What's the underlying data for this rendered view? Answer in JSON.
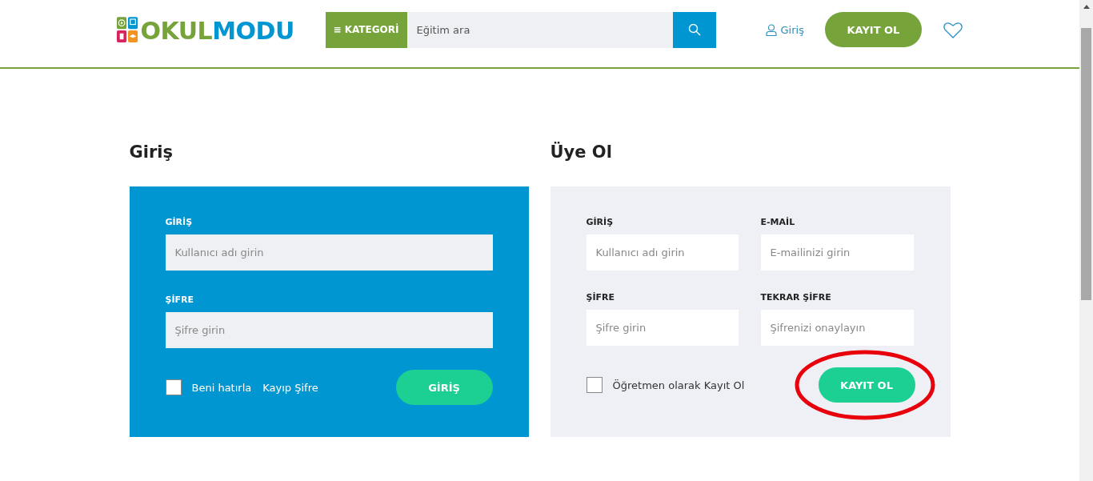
{
  "header": {
    "logo": {
      "part_1": "OKUL",
      "part_2": "MODU"
    },
    "category_button": "≡ KATEGORİ",
    "search": {
      "placeholder": "Eğitim ara"
    },
    "login_link": "Giriş",
    "register_button": "KAYIT OL"
  },
  "login": {
    "title": "Giriş",
    "fields": [
      {
        "label": "GİRİŞ",
        "placeholder": "Kullanıcı adı girin"
      },
      {
        "label": "ŞİFRE",
        "placeholder": "Şifre girin"
      }
    ],
    "remember": {
      "label": "Beni hatırla",
      "checked": false
    },
    "forgot_link": "Kayıp Şifre",
    "submit": "GİRİŞ"
  },
  "register": {
    "title": "Üye Ol",
    "fields": [
      {
        "label": "GİRİŞ",
        "placeholder": "Kullanıcı adı girin"
      },
      {
        "label": "E-MAİL",
        "placeholder": "E-mailinizi girin"
      },
      {
        "label": "ŞİFRE",
        "placeholder": "Şifre girin"
      },
      {
        "label": "TEKRAR ŞİFRE",
        "placeholder": "Şifrenizi onaylayın"
      }
    ],
    "teacher": {
      "label": "Öğretmen olarak Kayıt Ol",
      "checked": false
    },
    "submit": "KAYIT OL",
    "highlighted": true
  }
}
